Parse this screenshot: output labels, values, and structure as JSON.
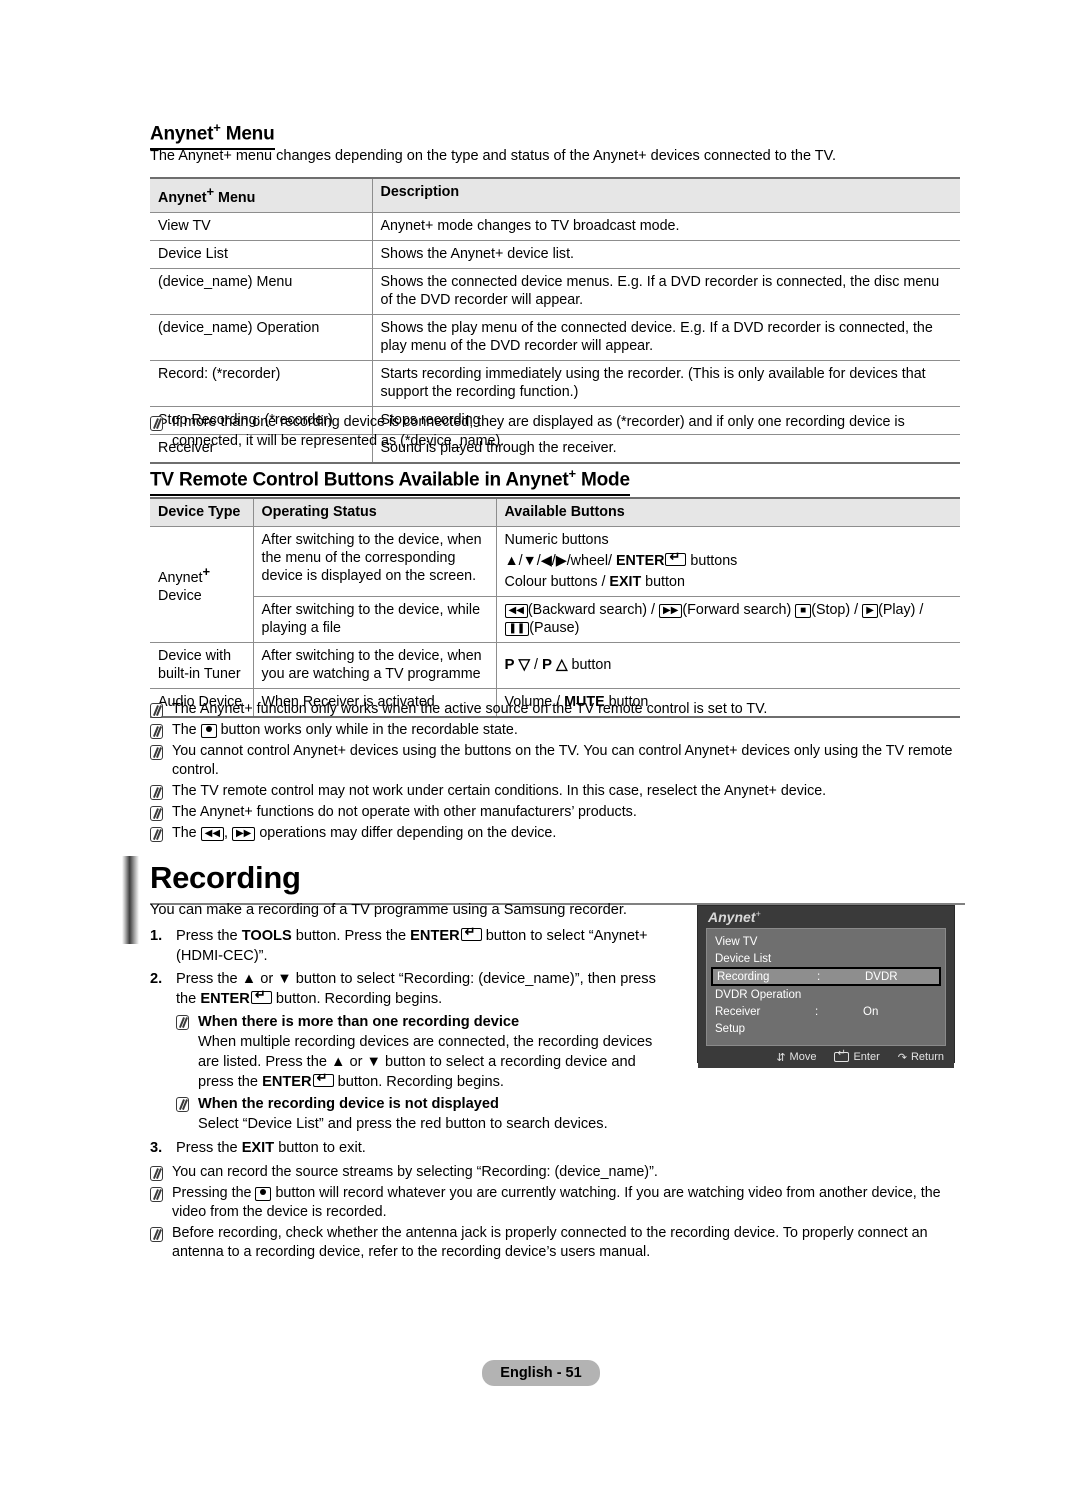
{
  "section1": {
    "heading_prefix": "Anynet",
    "heading_sup": "+",
    "heading_suffix": " Menu",
    "intro": "The Anynet+ menu changes depending on the type and status of the Anynet+ devices connected to the TV.",
    "table": {
      "headers": [
        "Anynet+ Menu",
        "Description"
      ],
      "header0_prefix": "Anynet",
      "header0_sup": "+",
      "header0_suffix": " Menu",
      "rows": [
        {
          "menu": "View TV",
          "description": "Anynet+ mode changes to TV broadcast mode."
        },
        {
          "menu": "Device List",
          "description": "Shows the Anynet+ device list."
        },
        {
          "menu": "(device_name) Menu",
          "description": "Shows the connected device menus. E.g. If a DVD recorder is connected, the disc menu of the DVD recorder will appear."
        },
        {
          "menu": "(device_name) Operation",
          "description": "Shows the play menu of the connected device. E.g. If a DVD recorder is connected, the play menu of the DVD recorder will appear."
        },
        {
          "menu": "Record: (*recorder)",
          "description": "Starts recording immediately using the recorder. (This is only available for devices that support the recording function.)"
        },
        {
          "menu": "Stop Recording: (*recorder)",
          "description": "Stops recording."
        },
        {
          "menu": "Receiver",
          "description": "Sound is played through the receiver."
        }
      ]
    },
    "note": "If more than one recording device is connected, they are displayed as (*recorder) and if only one recording device is connected, it will be represented as (*device_name)."
  },
  "section2": {
    "heading_prefix": "TV Remote Control Buttons Available in Anynet",
    "heading_sup": "+",
    "heading_suffix": " Mode",
    "table": {
      "headers": [
        "Device Type",
        "Operating Status",
        "Available Buttons"
      ],
      "device_anynet_prefix": "Anynet",
      "device_anynet_sup": "+",
      "device_anynet_suffix": " Device",
      "device_tuner": "Device with built-in Tuner",
      "device_audio": "Audio Device",
      "status_menu": "After switching to the device, when the menu of the corresponding device is displayed on the screen.",
      "status_playing": "After switching to the device, while playing a file",
      "status_watching": "After switching to the device, when you are watching a TV programme",
      "status_receiver": "When Receiver is activated",
      "buttons_numeric": "Numeric buttons",
      "buttons_nav_pre": "▲/▼/◀/▶/wheel/ ",
      "buttons_nav_enter": "ENTER",
      "buttons_nav_post": " buttons",
      "buttons_colour_pre": "Colour buttons / ",
      "buttons_colour_exit": "EXIT",
      "buttons_colour_post": " button",
      "buttons_media_back": "(Backward search) / ",
      "buttons_media_fwd": "(Forward search) ",
      "buttons_media_stop": "(Stop) / ",
      "buttons_media_play": "(Play) /",
      "buttons_media_pause": "(Pause)",
      "buttons_prog": "P ⌄ / P ⌃ button",
      "buttons_prog_p1": "P",
      "buttons_prog_sep": "/",
      "buttons_prog_p2": "P",
      "buttons_prog_tail": "button",
      "buttons_audio_pre": "Volume / ",
      "buttons_audio_mute": "MUTE",
      "buttons_audio_post": " button"
    },
    "notes": [
      "The Anynet+ function only works when the active source on the TV remote control is set to TV.",
      "button works only while in the recordable state.",
      "You cannot control Anynet+ devices using the buttons on the TV. You can control Anynet+ devices only using the TV remote control.",
      "The TV remote control may not work under certain conditions. In this case, reselect the Anynet+ device.",
      "The Anynet+ functions do not operate with other manufacturers’ products.",
      "operations may differ depending on the device."
    ],
    "note2_prefix": "The",
    "note6_prefix": "The",
    "note6_mid": ",",
    "note6_suffix": "operations may differ depending on the device."
  },
  "recording": {
    "title": "Recording",
    "intro": "You can make a recording of a TV programme using a Samsung recorder.",
    "step1": {
      "num": "1.",
      "a": "Press the ",
      "tools": "TOOLS",
      "b": " button. Press the ",
      "enter": "ENTER",
      "c": " button to select “Anynet+ (HDMI-CEC)”."
    },
    "step2": {
      "num": "2.",
      "a": "Press the ▲ or ▼ button to select “Recording: (device_name)”, then press the ",
      "enter": "ENTER",
      "b": " button. Recording begins."
    },
    "subnote1": {
      "heading": "When there is more than one recording device",
      "body_a": "When multiple recording devices are connected, the recording devices are listed. Press the ▲ or ▼ button to select a recording device and press the ",
      "enter": "ENTER",
      "body_b": " button. Recording begins."
    },
    "subnote2": {
      "heading": "When the recording device is not displayed",
      "body": "Select “Device List” and press the red button to search devices."
    },
    "step3": {
      "num": "3.",
      "a": "Press the ",
      "exit": "EXIT",
      "b": " button to exit."
    },
    "notes": [
      "You can record the source streams by selecting “Recording: (device_name)”.",
      "button will record whatever you are currently watching. If you are watching video from another device, the video from the device is recorded.",
      "Before recording, check whether the antenna jack is properly connected to the recording device. To properly connect an antenna to a recording device, refer to the recording device’s users manual."
    ],
    "note2_prefix": "Pressing the"
  },
  "osd": {
    "logo": "Anynet",
    "logo_sup": "+",
    "items": [
      {
        "label": "View TV",
        "colon": "",
        "value": "",
        "selected": false
      },
      {
        "label": "Device List",
        "colon": "",
        "value": "",
        "selected": false
      },
      {
        "label": "Recording",
        "colon": ":",
        "value": "DVDR",
        "selected": true
      },
      {
        "label": "DVDR Operation",
        "colon": "",
        "value": "",
        "selected": false
      },
      {
        "label": "Receiver",
        "colon": ":",
        "value": "On",
        "selected": false
      },
      {
        "label": "Setup",
        "colon": "",
        "value": "",
        "selected": false
      }
    ],
    "footer": {
      "move": "Move",
      "enter": "Enter",
      "return": "Return"
    }
  },
  "footer": {
    "page_label": "English - 51"
  }
}
